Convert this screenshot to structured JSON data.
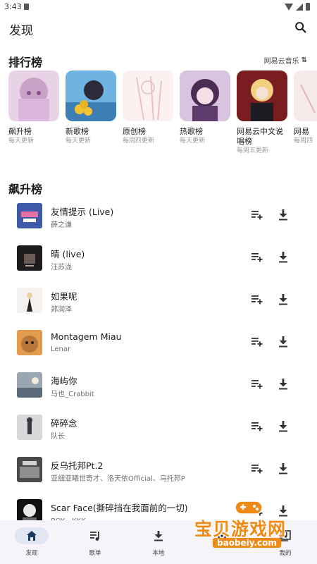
{
  "status_bar": {
    "time": "3:43"
  },
  "app_bar": {
    "title": "发现"
  },
  "ranking": {
    "title": "排行榜",
    "source_label": "网易云音乐",
    "cards": [
      {
        "name": "飙升榜",
        "update": "每天更新"
      },
      {
        "name": "新歌榜",
        "update": "每天更新"
      },
      {
        "name": "原创榜",
        "update": "每周四更新"
      },
      {
        "name": "热歌榜",
        "update": "每天更新"
      },
      {
        "name": "网易云中文说唱榜",
        "update": "每周五更新"
      },
      {
        "name": "网易",
        "update": "每周四"
      }
    ]
  },
  "soaring": {
    "title": "飙升榜",
    "songs": [
      {
        "title": "友情提示 (Live)",
        "artist": "薛之谦"
      },
      {
        "title": "晴 (live)",
        "artist": "汪苏泷"
      },
      {
        "title": "如果呢",
        "artist": "郑润泽"
      },
      {
        "title": "Montagem Miau",
        "artist": "Lenar"
      },
      {
        "title": "海屿你",
        "artist": "马也_Crabbit"
      },
      {
        "title": "碎碎念",
        "artist": "队长"
      },
      {
        "title": "反乌托邦Pt.2",
        "artist": "亚细亚曦世奇才、洛天依Official、乌托邦P"
      },
      {
        "title": "Scar Face(撕碎挡在我面前的一切)",
        "artist": "BOY、KKK"
      }
    ]
  },
  "bottom_nav": {
    "tabs": [
      {
        "label": "发现",
        "icon": "home-icon"
      },
      {
        "label": "歌单",
        "icon": "playlist-icon"
      },
      {
        "label": "本地",
        "icon": "download-icon"
      },
      {
        "label": "",
        "icon": "settings-icon"
      },
      {
        "label": "我的",
        "icon": "library-icon"
      }
    ],
    "active_index": 0
  },
  "watermark": {
    "text": "宝贝游戏网",
    "url": "baobeiy.com"
  },
  "colors": {
    "accent": "#e2e5f2",
    "watermark": "#f08a16"
  }
}
